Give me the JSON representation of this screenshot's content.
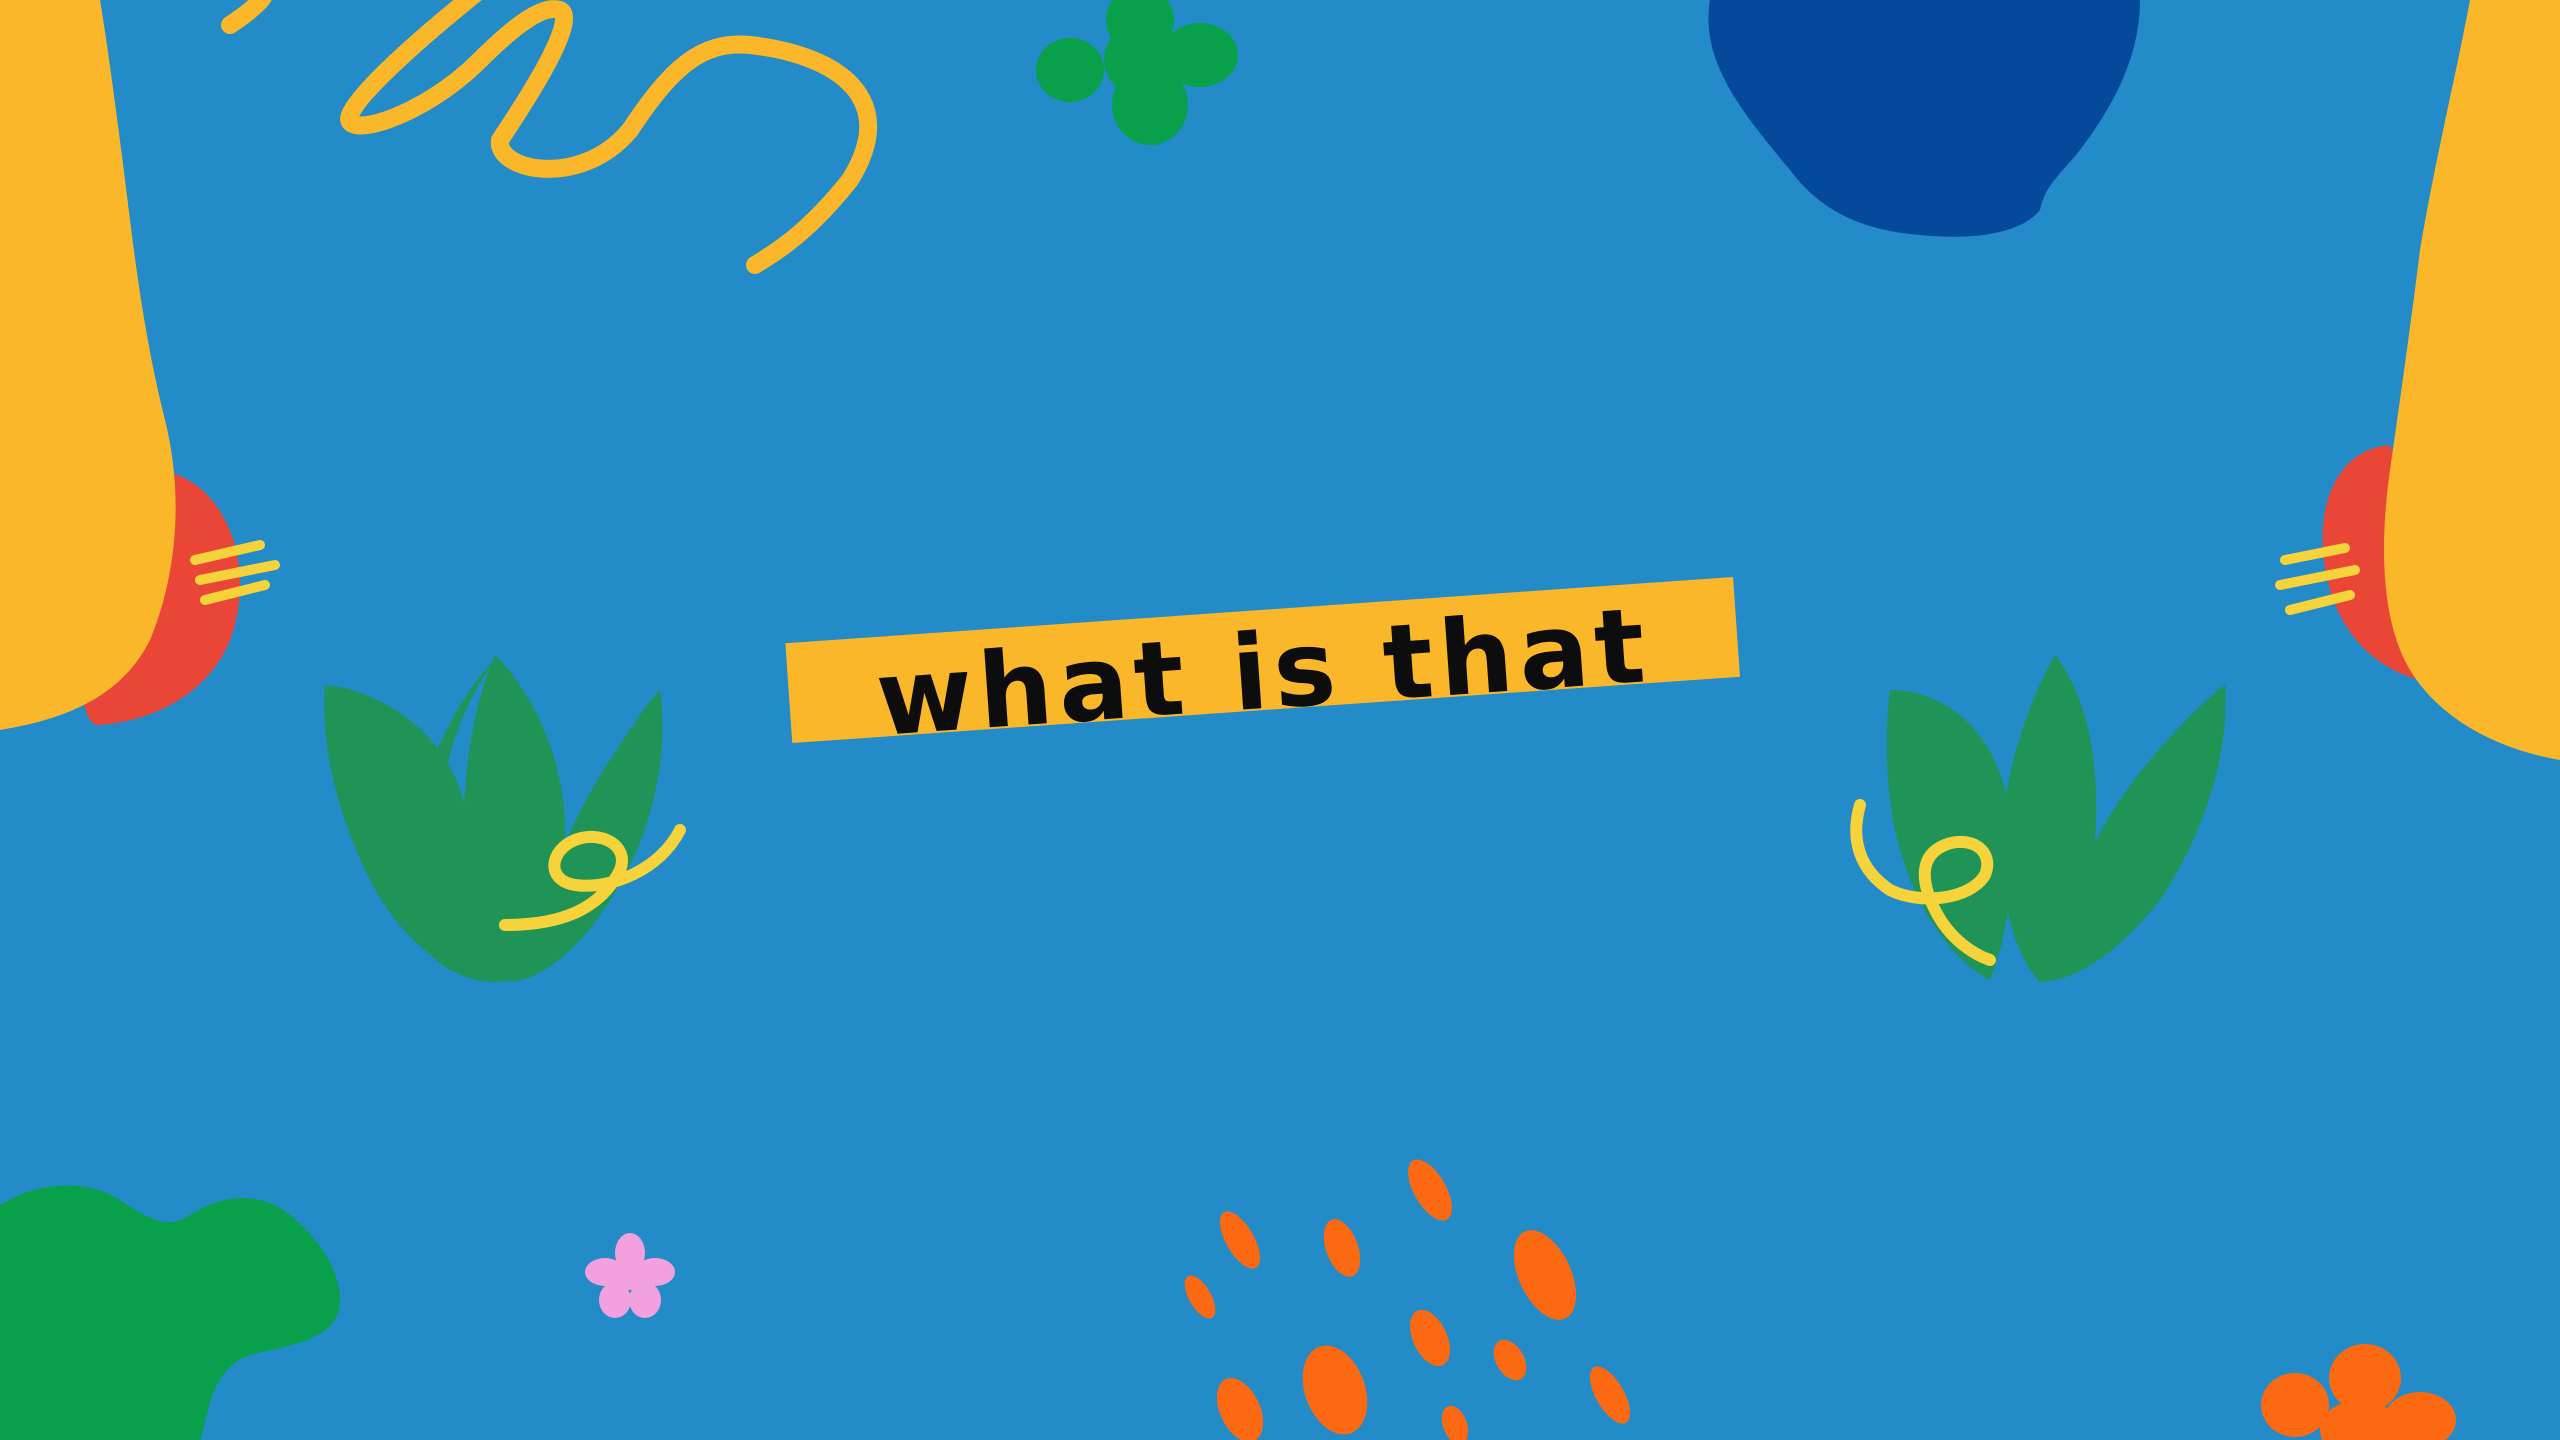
{
  "slide": {
    "title": "what is that",
    "background_color": "#238bc8"
  },
  "colors": {
    "banner": "#fbb72a",
    "yellow_shape": "#fbb72a",
    "red_shape": "#ea4638",
    "green_leaf": "#1f9456",
    "green_blob": "#08a04a",
    "navy_blob": "#04499a",
    "orange_dots": "#fb6a12",
    "pink_flower": "#f3a0de",
    "squiggle": "#f6d33b"
  },
  "decorations": [
    "yellow-swirl-doodle",
    "green-clover-icon",
    "navy-blob",
    "yellow-arm-left",
    "yellow-arm-right",
    "red-hand-left",
    "red-hand-right",
    "green-leaf-left",
    "green-leaf-right",
    "green-blob",
    "pink-flower-icon",
    "orange-dots",
    "orange-flower-icon"
  ]
}
